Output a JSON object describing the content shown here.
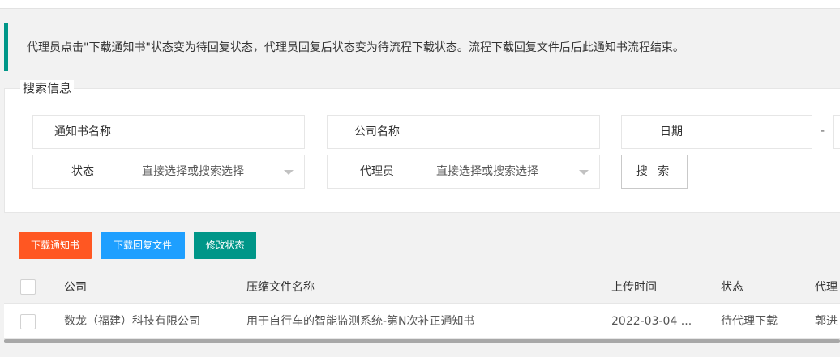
{
  "notice": {
    "text": "代理员点击\"下载通知书\"状态变为待回复状态，代理员回复后状态变为待流程下载状态。流程下载回复文件后后此通知书流程结束。"
  },
  "search": {
    "legend": "搜索信息",
    "fields": {
      "notice_name_label": "通知书名称",
      "notice_name_value": "",
      "company_name_label": "公司名称",
      "company_name_value": "",
      "date_label": "日期",
      "date_start_value": "",
      "date_separator": "-",
      "status_label": "状态",
      "status_placeholder": "直接选择或搜索选择",
      "agent_label": "代理员",
      "agent_placeholder": "直接选择或搜索选择"
    },
    "search_button": "搜 索"
  },
  "toolbar": {
    "download_notice": "下载通知书",
    "download_reply": "下载回复文件",
    "change_status": "修改状态"
  },
  "colors": {
    "orange": "#ff5722",
    "blue": "#1e9fff",
    "green": "#009688"
  },
  "table": {
    "headers": {
      "company": "公司",
      "filename": "压缩文件名称",
      "upload_time": "上传时间",
      "status": "状态",
      "agent": "代理"
    },
    "rows": [
      {
        "company": "数龙（福建）科技有限公司",
        "filename": "用于自行车的智能监测系统-第N次补正通知书",
        "upload_time": "2022-03-04 ...",
        "status": "待代理下载",
        "agent": "郭进"
      }
    ]
  }
}
